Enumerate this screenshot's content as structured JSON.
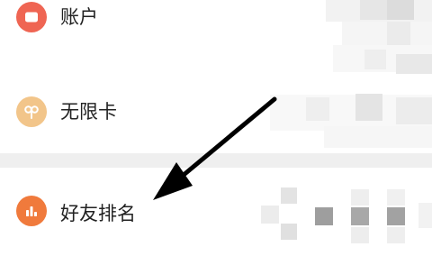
{
  "menu": {
    "items": [
      {
        "label": "账户",
        "icon": "wallet-icon",
        "color": "#ef6553"
      },
      {
        "label": "无限卡",
        "icon": "card-clover-icon",
        "color": "#f2c58a"
      },
      {
        "label": "好友排名",
        "icon": "bar-chart-icon",
        "color": "#f07a3c"
      }
    ]
  },
  "colors": {
    "divider": "#efefef",
    "annotation_arrow": "#000000",
    "text": "#222222"
  }
}
